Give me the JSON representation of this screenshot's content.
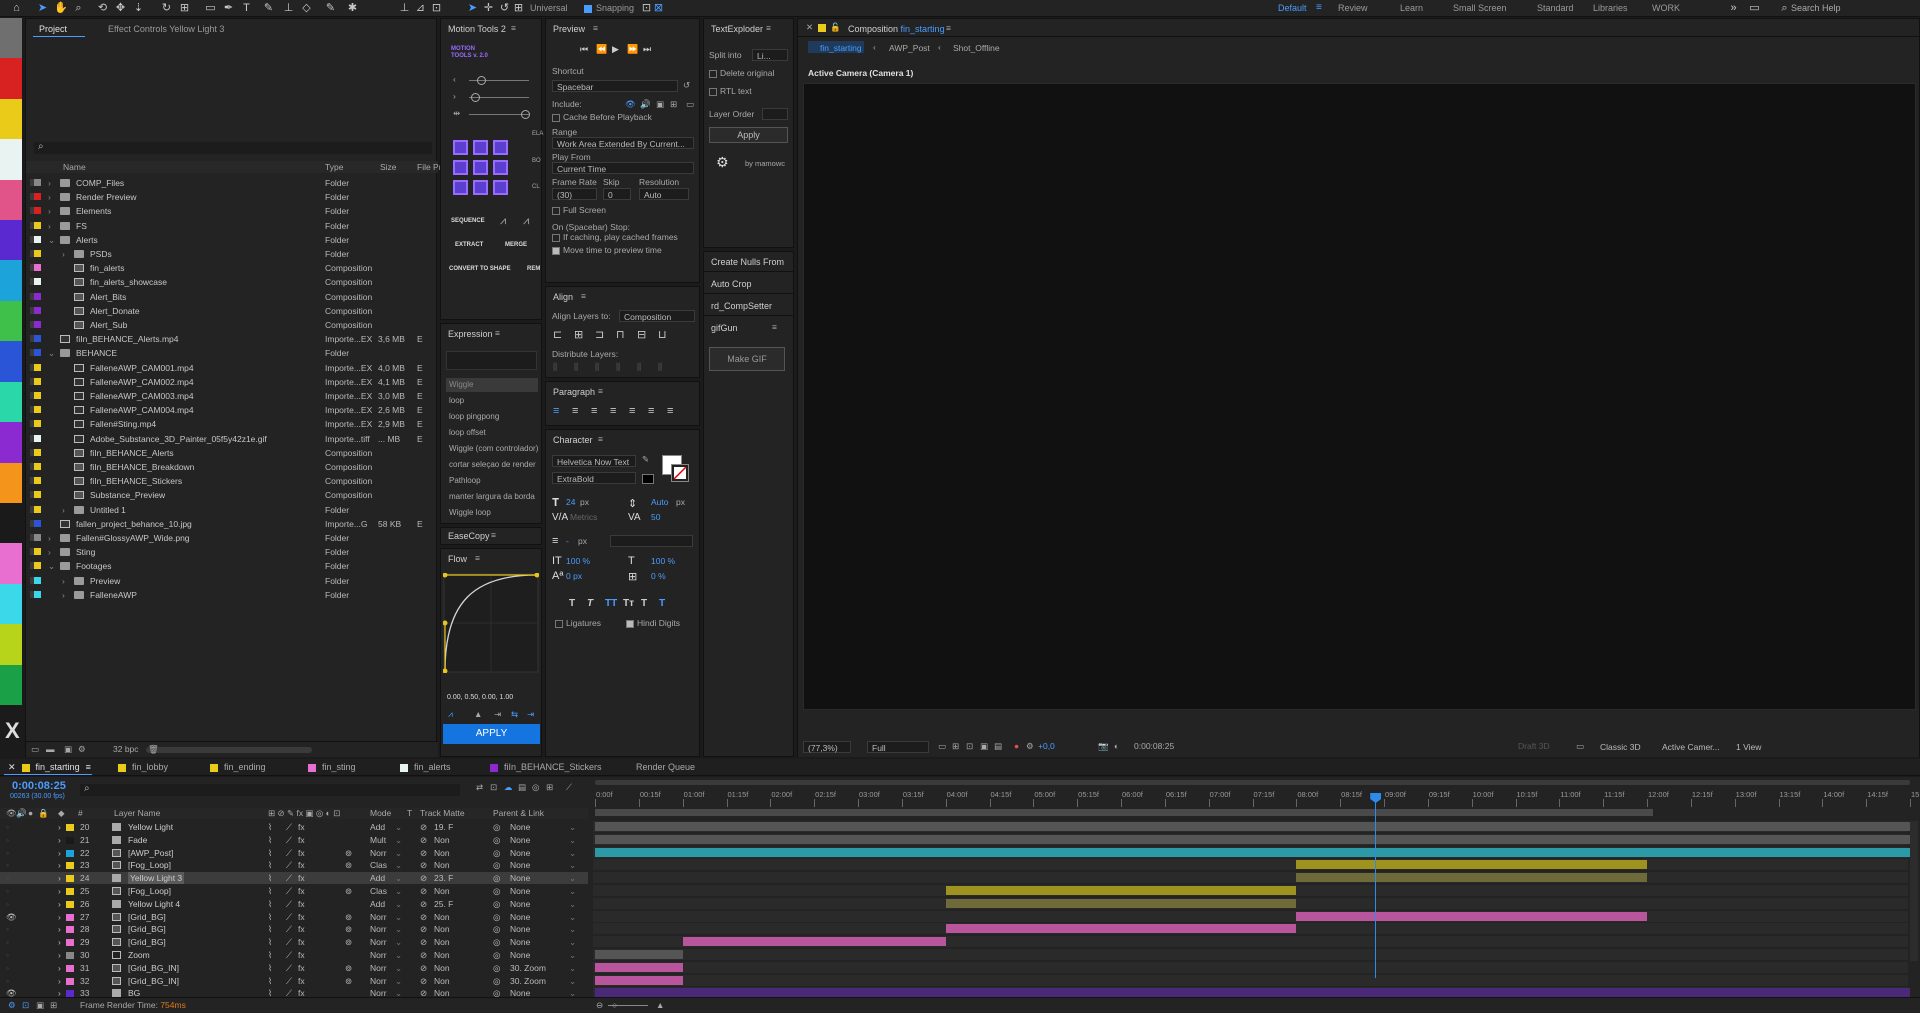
{
  "toolbar": {
    "universal": "Universal",
    "snapping": "Snapping",
    "workspaces": [
      "Default",
      "Review",
      "Learn",
      "Small Screen",
      "Standard",
      "Libraries",
      "WORK"
    ],
    "active_workspace": "Default",
    "search": "Search Help"
  },
  "palette": [
    "#6f6f6f",
    "#d82121",
    "#eacb1a",
    "#e8f3f2",
    "#e15489",
    "#5a2ad0",
    "#1ca4da",
    "#3fc04a",
    "#2a55d6",
    "#2ad7a9",
    "#8a2ad0",
    "#f5941a",
    "#1a1a1a",
    "#e86fd0",
    "#3ad8e8",
    "#b8d41a",
    "#1aa047"
  ],
  "project": {
    "tab": "Project",
    "effect_tab": "Effect Controls Yellow Light 3",
    "cols": {
      "name": "Name",
      "type": "Type",
      "size": "Size",
      "file": "File Pr"
    },
    "items": [
      {
        "name": "COMP_Files",
        "type": "Folder",
        "size": "",
        "color": "#888",
        "ind": 0,
        "kind": "folder",
        "exp": "›"
      },
      {
        "name": "Render Preview",
        "type": "Folder",
        "size": "",
        "color": "#d82121",
        "ind": 0,
        "kind": "folder",
        "exp": "›"
      },
      {
        "name": "Elements",
        "type": "Folder",
        "size": "",
        "color": "#d82121",
        "ind": 0,
        "kind": "folder",
        "exp": "›"
      },
      {
        "name": "FS",
        "type": "Folder",
        "size": "",
        "color": "#eacb1a",
        "ind": 0,
        "kind": "folder",
        "exp": "›"
      },
      {
        "name": "Alerts",
        "type": "Folder",
        "size": "",
        "color": "#e8f3f2",
        "ind": 0,
        "kind": "folder",
        "exp": "⌄"
      },
      {
        "name": "PSDs",
        "type": "Folder",
        "size": "",
        "color": "#eacb1a",
        "ind": 1,
        "kind": "folder",
        "exp": "›"
      },
      {
        "name": "fin_alerts",
        "type": "Composition",
        "size": "",
        "color": "#e86fd0",
        "ind": 1,
        "kind": "comp",
        "exp": ""
      },
      {
        "name": "fin_alerts_showcase",
        "type": "Composition",
        "size": "",
        "color": "#e8f3f2",
        "ind": 1,
        "kind": "comp",
        "exp": ""
      },
      {
        "name": "Alert_Bits",
        "type": "Composition",
        "size": "",
        "color": "#8a2ad0",
        "ind": 1,
        "kind": "comp",
        "exp": ""
      },
      {
        "name": "Alert_Donate",
        "type": "Composition",
        "size": "",
        "color": "#8a2ad0",
        "ind": 1,
        "kind": "comp",
        "exp": ""
      },
      {
        "name": "Alert_Sub",
        "type": "Composition",
        "size": "",
        "color": "#8a2ad0",
        "ind": 1,
        "kind": "comp",
        "exp": ""
      },
      {
        "name": "fiIn_BEHANCE_Alerts.mp4",
        "type": "Importe...EX",
        "size": "3,6 MB",
        "color": "#2a55d6",
        "ind": 0,
        "kind": "file",
        "exp": ""
      },
      {
        "name": "BEHANCE",
        "type": "Folder",
        "size": "",
        "color": "#2a55d6",
        "ind": 0,
        "kind": "folder",
        "exp": "⌄"
      },
      {
        "name": "FalleneAWP_CAM001.mp4",
        "type": "Importe...EX",
        "size": "4,0 MB",
        "color": "#eacb1a",
        "ind": 1,
        "kind": "file",
        "exp": ""
      },
      {
        "name": "FalleneAWP_CAM002.mp4",
        "type": "Importe...EX",
        "size": "4,1 MB",
        "color": "#eacb1a",
        "ind": 1,
        "kind": "file",
        "exp": ""
      },
      {
        "name": "FalleneAWP_CAM003.mp4",
        "type": "Importe...EX",
        "size": "3,0 MB",
        "color": "#eacb1a",
        "ind": 1,
        "kind": "file",
        "exp": ""
      },
      {
        "name": "FalleneAWP_CAM004.mp4",
        "type": "Importe...EX",
        "size": "2,6 MB",
        "color": "#eacb1a",
        "ind": 1,
        "kind": "file",
        "exp": ""
      },
      {
        "name": "Fallen#Sting.mp4",
        "type": "Importe...EX",
        "size": "2,9 MB",
        "color": "#eacb1a",
        "ind": 1,
        "kind": "file",
        "exp": ""
      },
      {
        "name": "Adobe_Substance_3D_Painter_05f5y42z1e.gif",
        "type": "Importe...tiff",
        "size": "... MB",
        "color": "#e8f3f2",
        "ind": 1,
        "kind": "file",
        "exp": ""
      },
      {
        "name": "fiIn_BEHANCE_Alerts",
        "type": "Composition",
        "size": "",
        "color": "#eacb1a",
        "ind": 1,
        "kind": "comp",
        "exp": ""
      },
      {
        "name": "fiIn_BEHANCE_Breakdown",
        "type": "Composition",
        "size": "",
        "color": "#eacb1a",
        "ind": 1,
        "kind": "comp",
        "exp": ""
      },
      {
        "name": "fiIn_BEHANCE_Stickers",
        "type": "Composition",
        "size": "",
        "color": "#eacb1a",
        "ind": 1,
        "kind": "comp",
        "exp": ""
      },
      {
        "name": "Substance_Preview",
        "type": "Composition",
        "size": "",
        "color": "#eacb1a",
        "ind": 1,
        "kind": "comp",
        "exp": ""
      },
      {
        "name": "Untitled 1",
        "type": "Folder",
        "size": "",
        "color": "#eacb1a",
        "ind": 1,
        "kind": "folder",
        "exp": "›"
      },
      {
        "name": "fallen_project_behance_10.jpg",
        "type": "Importe...G",
        "size": "58 KB",
        "color": "#2a55d6",
        "ind": 0,
        "kind": "file",
        "exp": ""
      },
      {
        "name": "Fallen#GlossyAWP_Wide.png",
        "type": "Folder",
        "size": "",
        "color": "#888",
        "ind": 0,
        "kind": "folder",
        "exp": "›"
      },
      {
        "name": "Sting",
        "type": "Folder",
        "size": "",
        "color": "#eacb1a",
        "ind": 0,
        "kind": "folder",
        "exp": "›"
      },
      {
        "name": "Footages",
        "type": "Folder",
        "size": "",
        "color": "#eacb1a",
        "ind": 0,
        "kind": "folder",
        "exp": "⌄"
      },
      {
        "name": "Preview",
        "type": "Folder",
        "size": "",
        "color": "#3ad8e8",
        "ind": 1,
        "kind": "folder",
        "exp": "›"
      },
      {
        "name": "FalleneAWP",
        "type": "Folder",
        "size": "",
        "color": "#3ad8e8",
        "ind": 1,
        "kind": "folder",
        "exp": "›"
      }
    ],
    "bpc": "32 bpc"
  },
  "motion": {
    "title": "Motion Tools 2",
    "logo": "MOTION TOOLS v. 2.0",
    "sequence": "SEQUENCE",
    "extract": "EXTRACT",
    "merge": "MERGE",
    "convert": "CONVERT TO SHAPE",
    "rem": "REM",
    "ela": "ELA",
    "bo": "BO",
    "cl": "CL"
  },
  "expression": {
    "title": "Expression",
    "items": [
      "Wiggle",
      "loop",
      "loop pingpong",
      "loop offset",
      "Wiggle (com controlador)",
      "cortar seleçao de render",
      "Pathloop",
      "manter largura da borda",
      "Wiggle loop"
    ]
  },
  "easecopy": {
    "title": "EaseCopy"
  },
  "flow": {
    "title": "Flow",
    "values": "0.00, 0.50, 0.00, 1.00",
    "apply": "APPLY"
  },
  "preview": {
    "title": "Preview",
    "shortcut_label": "Shortcut",
    "shortcut": "Spacebar",
    "include": "Include:",
    "cache": "Cache Before Playback",
    "range_label": "Range",
    "range": "Work Area Extended By Current...",
    "playfrom_label": "Play From",
    "playfrom": "Current Time",
    "framerate_label": "Frame Rate",
    "skip_label": "Skip",
    "resolution_label": "Resolution",
    "framerate": "(30)",
    "skip": "0",
    "resolution": "Auto",
    "fullscreen": "Full Screen",
    "stop_label": "On (Spacebar) Stop:",
    "cached": "If caching, play cached frames",
    "movetime": "Move time to preview time"
  },
  "align": {
    "title": "Align",
    "align_to_label": "Align Layers to:",
    "align_to": "Composition",
    "distribute": "Distribute Layers:"
  },
  "paragraph": {
    "title": "Paragraph"
  },
  "character": {
    "title": "Character",
    "font": "Helvetica Now Text",
    "style": "ExtraBold",
    "size": "24",
    "size_unit": "px",
    "leading": "Auto",
    "leading_unit": "px",
    "kerning": "Metrics",
    "tracking": "50",
    "stroke": "-",
    "stroke_unit": "px",
    "vscale": "100 %",
    "hscale": "100 %",
    "baseline": "0 px",
    "tsume": "0 %",
    "ligatures": "Ligatures",
    "hindi": "Hindi Digits"
  },
  "textexploder": {
    "title": "TextExploder",
    "split_label": "Split into",
    "split": "Li...",
    "delete": "Delete original",
    "rtl": "RTL text",
    "order_label": "Layer Order",
    "apply": "Apply",
    "by": "by mamowc"
  },
  "scripts": {
    "create_nulls": "Create Nulls From",
    "auto_crop": "Auto Crop",
    "comp_setter": "rd_CompSetter",
    "gifgun": "gifGun",
    "make_gif": "Make GIF"
  },
  "composition": {
    "title": "Composition",
    "comp_name": "fin_starting",
    "crumbs": [
      "fin_starting",
      "AWP_Post",
      "Shot_Offline"
    ],
    "camera": "Active Camera (Camera 1)",
    "zoom": "(77,3%)",
    "quality": "Full",
    "timecode": "0:00:08:25",
    "draft": "Draft 3D",
    "renderer": "Classic 3D",
    "view_camera": "Active Camer...",
    "views": "1 View",
    "exposure": "+0,0"
  },
  "timeline": {
    "tabs": [
      {
        "name": "fin_starting",
        "color": "#eacb1a",
        "active": true
      },
      {
        "name": "fin_lobby",
        "color": "#eacb1a"
      },
      {
        "name": "fin_ending",
        "color": "#eacb1a"
      },
      {
        "name": "fin_sting",
        "color": "#e86fd0"
      },
      {
        "name": "fin_alerts",
        "color": "#e8f3f2"
      },
      {
        "name": "fiIn_BEHANCE_Stickers",
        "color": "#8a2ad0"
      },
      {
        "name": "Render Queue",
        "color": ""
      }
    ],
    "time": "0:00:08:25",
    "fps": "00263 (30.00 fps)",
    "cols": {
      "layer": "Layer Name",
      "mode": "Mode",
      "t": "T",
      "matte": "Track Matte",
      "parent": "Parent & Link"
    },
    "ruler": [
      "0:00f",
      "00:15f",
      "01:00f",
      "01:15f",
      "02:00f",
      "02:15f",
      "03:00f",
      "03:15f",
      "04:00f",
      "04:15f",
      "05:00f",
      "05:15f",
      "06:00f",
      "06:15f",
      "07:00f",
      "07:15f",
      "08:00f",
      "08:15f",
      "09:00f",
      "09:15f",
      "10:00f",
      "10:15f",
      "11:00f",
      "11:15f",
      "12:00f",
      "12:15f",
      "13:00f",
      "13:15f",
      "14:00f",
      "14:15f",
      "15:00"
    ],
    "render_time_label": "Frame Render Time:",
    "render_time": "754ms",
    "layers": [
      {
        "n": "20",
        "name": "Yellow Light",
        "color": "#eacb1a",
        "mode": "Add",
        "matte": "19. F",
        "parent": "None",
        "type": "solid",
        "bar": {
          "start": 0,
          "end": 30,
          "color": "#555"
        }
      },
      {
        "n": "21",
        "name": "Fade",
        "color": "#1a1a1a",
        "mode": "Mult",
        "matte": "Non",
        "parent": "None",
        "type": "solid",
        "bar": {
          "start": 0,
          "end": 30,
          "color": "#555"
        }
      },
      {
        "n": "22",
        "name": "[AWP_Post]",
        "color": "#1ca4da",
        "mode": "Norr",
        "matte": "Non",
        "parent": "None",
        "type": "comp",
        "bar": {
          "start": 0,
          "end": 30,
          "color": "#2c9aa6"
        }
      },
      {
        "n": "23",
        "name": "[Fog_Loop]",
        "color": "#eacb1a",
        "mode": "Clas",
        "matte": "Non",
        "parent": "None",
        "type": "comp",
        "bar": {
          "start": 16,
          "end": 24,
          "color": "#9f9320"
        }
      },
      {
        "n": "24",
        "name": "Yellow Light 3",
        "color": "#eacb1a",
        "mode": "Add",
        "matte": "23. F",
        "parent": "None",
        "type": "solid",
        "bar": {
          "start": 16,
          "end": 24,
          "color": "#6f6a3a"
        },
        "selected": true
      },
      {
        "n": "25",
        "name": "[Fog_Loop]",
        "color": "#eacb1a",
        "mode": "Clas",
        "matte": "Non",
        "parent": "None",
        "type": "comp",
        "bar": {
          "start": 8,
          "end": 16,
          "color": "#9f9320"
        }
      },
      {
        "n": "26",
        "name": "Yellow Light 4",
        "color": "#eacb1a",
        "mode": "Add",
        "matte": "25. F",
        "parent": "None",
        "type": "solid",
        "bar": {
          "start": 8,
          "end": 16,
          "color": "#6f6a3a"
        }
      },
      {
        "n": "27",
        "name": "[Grid_BG]",
        "color": "#e86fd0",
        "mode": "Norr",
        "matte": "Non",
        "parent": "None",
        "type": "comp",
        "bar": {
          "start": 16,
          "end": 24,
          "color": "#b8559c"
        }
      },
      {
        "n": "28",
        "name": "[Grid_BG]",
        "color": "#e86fd0",
        "mode": "Norr",
        "matte": "Non",
        "parent": "None",
        "type": "comp",
        "bar": {
          "start": 8,
          "end": 16,
          "color": "#b8559c"
        }
      },
      {
        "n": "29",
        "name": "[Grid_BG]",
        "color": "#e86fd0",
        "mode": "Norr",
        "matte": "Non",
        "parent": "None",
        "type": "comp",
        "bar": {
          "start": 2,
          "end": 8,
          "color": "#b8559c"
        }
      },
      {
        "n": "30",
        "name": "Zoom",
        "color": "#888",
        "mode": "Norr",
        "matte": "Non",
        "parent": "None",
        "type": "null",
        "bar": {
          "start": 0,
          "end": 2,
          "color": "#555"
        }
      },
      {
        "n": "31",
        "name": "[Grid_BG_IN]",
        "color": "#e86fd0",
        "mode": "Norr",
        "matte": "Non",
        "parent": "30. Zoom",
        "type": "comp",
        "bar": {
          "start": 0,
          "end": 2,
          "color": "#b8559c"
        }
      },
      {
        "n": "32",
        "name": "[Grid_BG_IN]",
        "color": "#e86fd0",
        "mode": "Norr",
        "matte": "Non",
        "parent": "30. Zoom",
        "type": "comp",
        "bar": {
          "start": 0,
          "end": 2,
          "color": "#b8559c"
        }
      },
      {
        "n": "33",
        "name": "BG",
        "color": "#5a2ad0",
        "mode": "Norr",
        "matte": "Non",
        "parent": "None",
        "type": "solid",
        "bar": {
          "start": 0,
          "end": 30,
          "color": "#4a2a78"
        }
      }
    ],
    "playhead_frame": 17.8,
    "work_area_end": 24
  }
}
